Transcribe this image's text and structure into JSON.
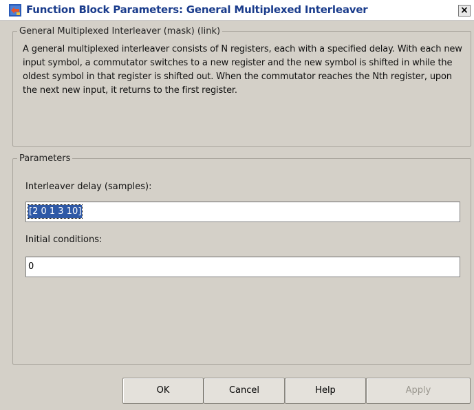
{
  "window": {
    "title": "Function Block Parameters: General Multiplexed Interleaver",
    "close_glyph": "×"
  },
  "description": {
    "legend": "General Multiplexed Interleaver (mask) (link)",
    "text": "A general multiplexed interleaver consists of N registers, each with a specified delay.  With each new input symbol, a commutator switches to a new register and the new symbol is shifted in while the oldest symbol in that register is shifted out. When the commutator reaches the Nth register, upon the next new input, it returns to the first register."
  },
  "parameters": {
    "legend": "Parameters",
    "interleaver_delay": {
      "label": "Interleaver delay (samples):",
      "value": "[2 0 1 3 10]"
    },
    "initial_conditions": {
      "label": "Initial conditions:",
      "value": "0"
    }
  },
  "buttons": {
    "ok": "OK",
    "cancel": "Cancel",
    "help": "Help",
    "apply": "Apply"
  }
}
